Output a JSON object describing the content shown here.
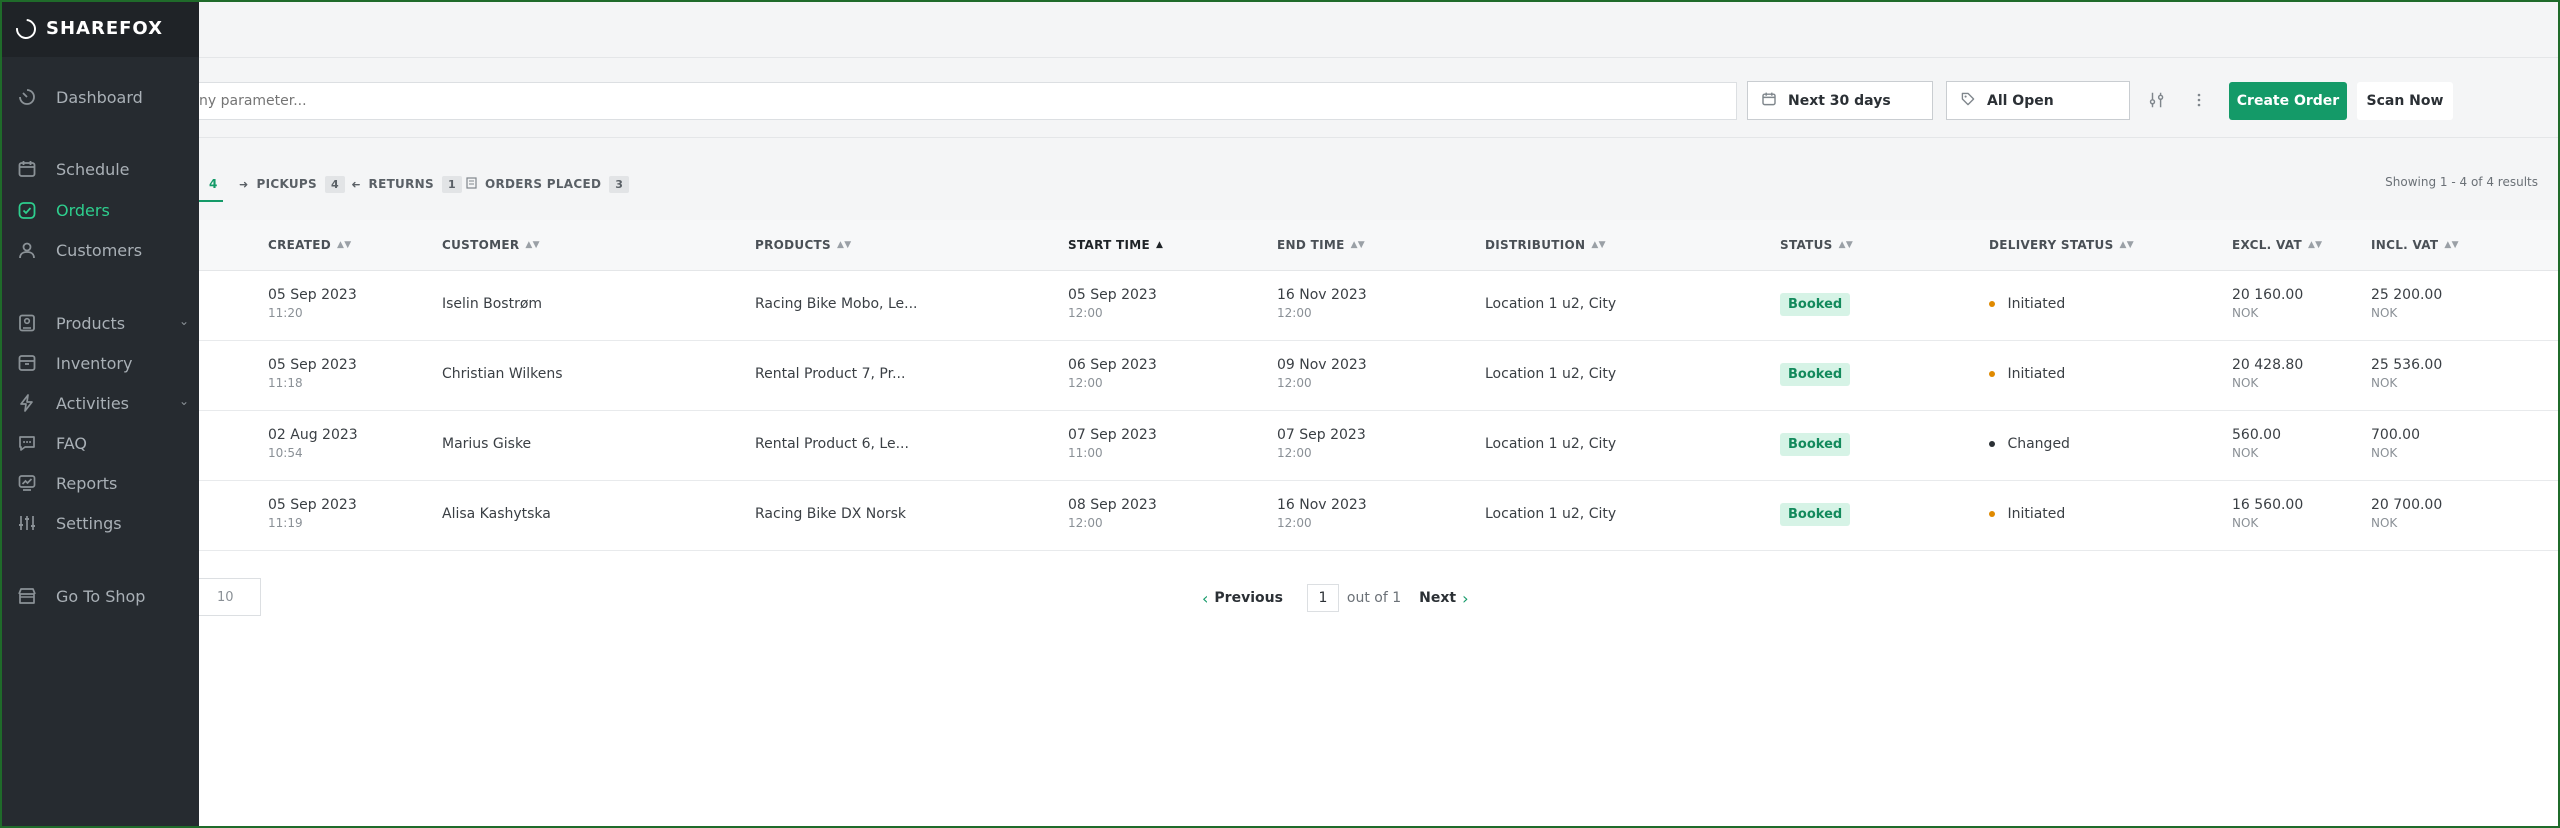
{
  "brand": {
    "name": "SHAREFOX"
  },
  "nav": {
    "items": [
      {
        "label": "Dashboard",
        "icon": "dashboard-icon"
      },
      {
        "label": "Schedule",
        "icon": "calendar-icon"
      },
      {
        "label": "Orders",
        "icon": "orders-icon",
        "active": true
      },
      {
        "label": "Customers",
        "icon": "user-icon"
      },
      {
        "label": "Products",
        "icon": "product-icon",
        "expandable": true
      },
      {
        "label": "Inventory",
        "icon": "inventory-icon"
      },
      {
        "label": "Activities",
        "icon": "bolt-icon",
        "expandable": true
      },
      {
        "label": "FAQ",
        "icon": "chat-icon"
      },
      {
        "label": "Reports",
        "icon": "chart-icon"
      },
      {
        "label": "Settings",
        "icon": "sliders-icon"
      },
      {
        "label": "Go To Shop",
        "icon": "shop-icon"
      }
    ]
  },
  "toolbar": {
    "search_placeholder": "ny parameter...",
    "date_filter": "Next 30 days",
    "status_filter": "All Open",
    "create_label": "Create Order",
    "scan_label": "Scan Now"
  },
  "tabs": {
    "items": [
      {
        "label": "",
        "count": "4",
        "active": true
      },
      {
        "label": "PICKUPS",
        "count": "4"
      },
      {
        "label": "RETURNS",
        "count": "1"
      },
      {
        "label": "ORDERS PLACED",
        "count": "3"
      }
    ],
    "showing": "Showing 1 - 4 of 4 results"
  },
  "table": {
    "headers": {
      "created": "CREATED",
      "customer": "CUSTOMER",
      "products": "PRODUCTS",
      "start_time": "START TIME",
      "end_time": "END TIME",
      "distribution": "DISTRIBUTION",
      "status": "STATUS",
      "delivery_status": "DELIVERY STATUS",
      "excl_vat": "EXCL. VAT",
      "incl_vat": "INCL. VAT"
    },
    "rows": [
      {
        "created_date": "05 Sep 2023",
        "created_time": "11:20",
        "customer": "Iselin Bostrøm",
        "products": "Racing Bike Mobo, Le...",
        "start_date": "05 Sep 2023",
        "start_time": "12:00",
        "end_date": "16 Nov 2023",
        "end_time": "12:00",
        "distribution": "Location 1 u2, City",
        "status": "Booked",
        "delivery_status": "Initiated",
        "delivery_color": "#e08a00",
        "excl_vat": "20 160.00",
        "excl_cur": "NOK",
        "incl_vat": "25 200.00",
        "incl_cur": "NOK"
      },
      {
        "created_date": "05 Sep 2023",
        "created_time": "11:18",
        "customer": "Christian Wilkens",
        "products": "Rental Product 7, Pr...",
        "start_date": "06 Sep 2023",
        "start_time": "12:00",
        "end_date": "09 Nov 2023",
        "end_time": "12:00",
        "distribution": "Location 1 u2, City",
        "status": "Booked",
        "delivery_status": "Initiated",
        "delivery_color": "#e08a00",
        "excl_vat": "20 428.80",
        "excl_cur": "NOK",
        "incl_vat": "25 536.00",
        "incl_cur": "NOK"
      },
      {
        "created_date": "02 Aug 2023",
        "created_time": "10:54",
        "customer": "Marius Giske",
        "products": "Rental Product 6, Le...",
        "start_date": "07 Sep 2023",
        "start_time": "11:00",
        "end_date": "07 Sep 2023",
        "end_time": "12:00",
        "distribution": "Location 1 u2, City",
        "status": "Booked",
        "delivery_status": "Changed",
        "delivery_color": "#2b3035",
        "excl_vat": "560.00",
        "excl_cur": "NOK",
        "incl_vat": "700.00",
        "incl_cur": "NOK"
      },
      {
        "created_date": "05 Sep 2023",
        "created_time": "11:19",
        "customer": "Alisa Kashytska",
        "products": "Racing Bike DX Norsk",
        "start_date": "08 Sep 2023",
        "start_time": "12:00",
        "end_date": "16 Nov 2023",
        "end_time": "12:00",
        "distribution": "Location 1 u2, City",
        "status": "Booked",
        "delivery_status": "Initiated",
        "delivery_color": "#e08a00",
        "excl_vat": "16 560.00",
        "excl_cur": "NOK",
        "incl_vat": "20 700.00",
        "incl_cur": "NOK"
      }
    ]
  },
  "pagination": {
    "per_page": "10",
    "previous": "Previous",
    "page": "1",
    "out_of": "out of 1",
    "next": "Next"
  },
  "colors": {
    "accent": "#149a68",
    "sidebar": "#262b30",
    "badge_bg": "#d6f3e6"
  }
}
